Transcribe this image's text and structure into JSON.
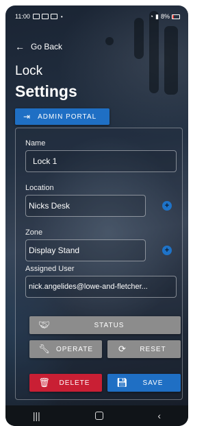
{
  "status_bar": {
    "time": "11:00",
    "battery": "8%"
  },
  "nav": {
    "back_label": "Go Back"
  },
  "page": {
    "title_line1": "Lock",
    "title_line2": "Settings"
  },
  "admin_portal": {
    "label": "ADMIN PORTAL",
    "icon": "login-icon"
  },
  "form": {
    "name_label": "Name",
    "name_value": "Lock 1",
    "location_label": "Location",
    "location_value": "Nicks Desk",
    "zone_label": "Zone",
    "zone_value": "Display Stand",
    "assigned_user_label": "Assigned User",
    "assigned_user_value": "nick.angelides@lowe-and-fletcher..."
  },
  "actions": {
    "status_label": "STATUS",
    "operate_label": "OPERATE",
    "reset_label": "RESET",
    "delete_label": "DELETE",
    "save_label": "SAVE"
  },
  "colors": {
    "primary_blue": "#1f6fc4",
    "danger_red": "#c91f34",
    "neutral_grey": "#8c8c8c"
  }
}
